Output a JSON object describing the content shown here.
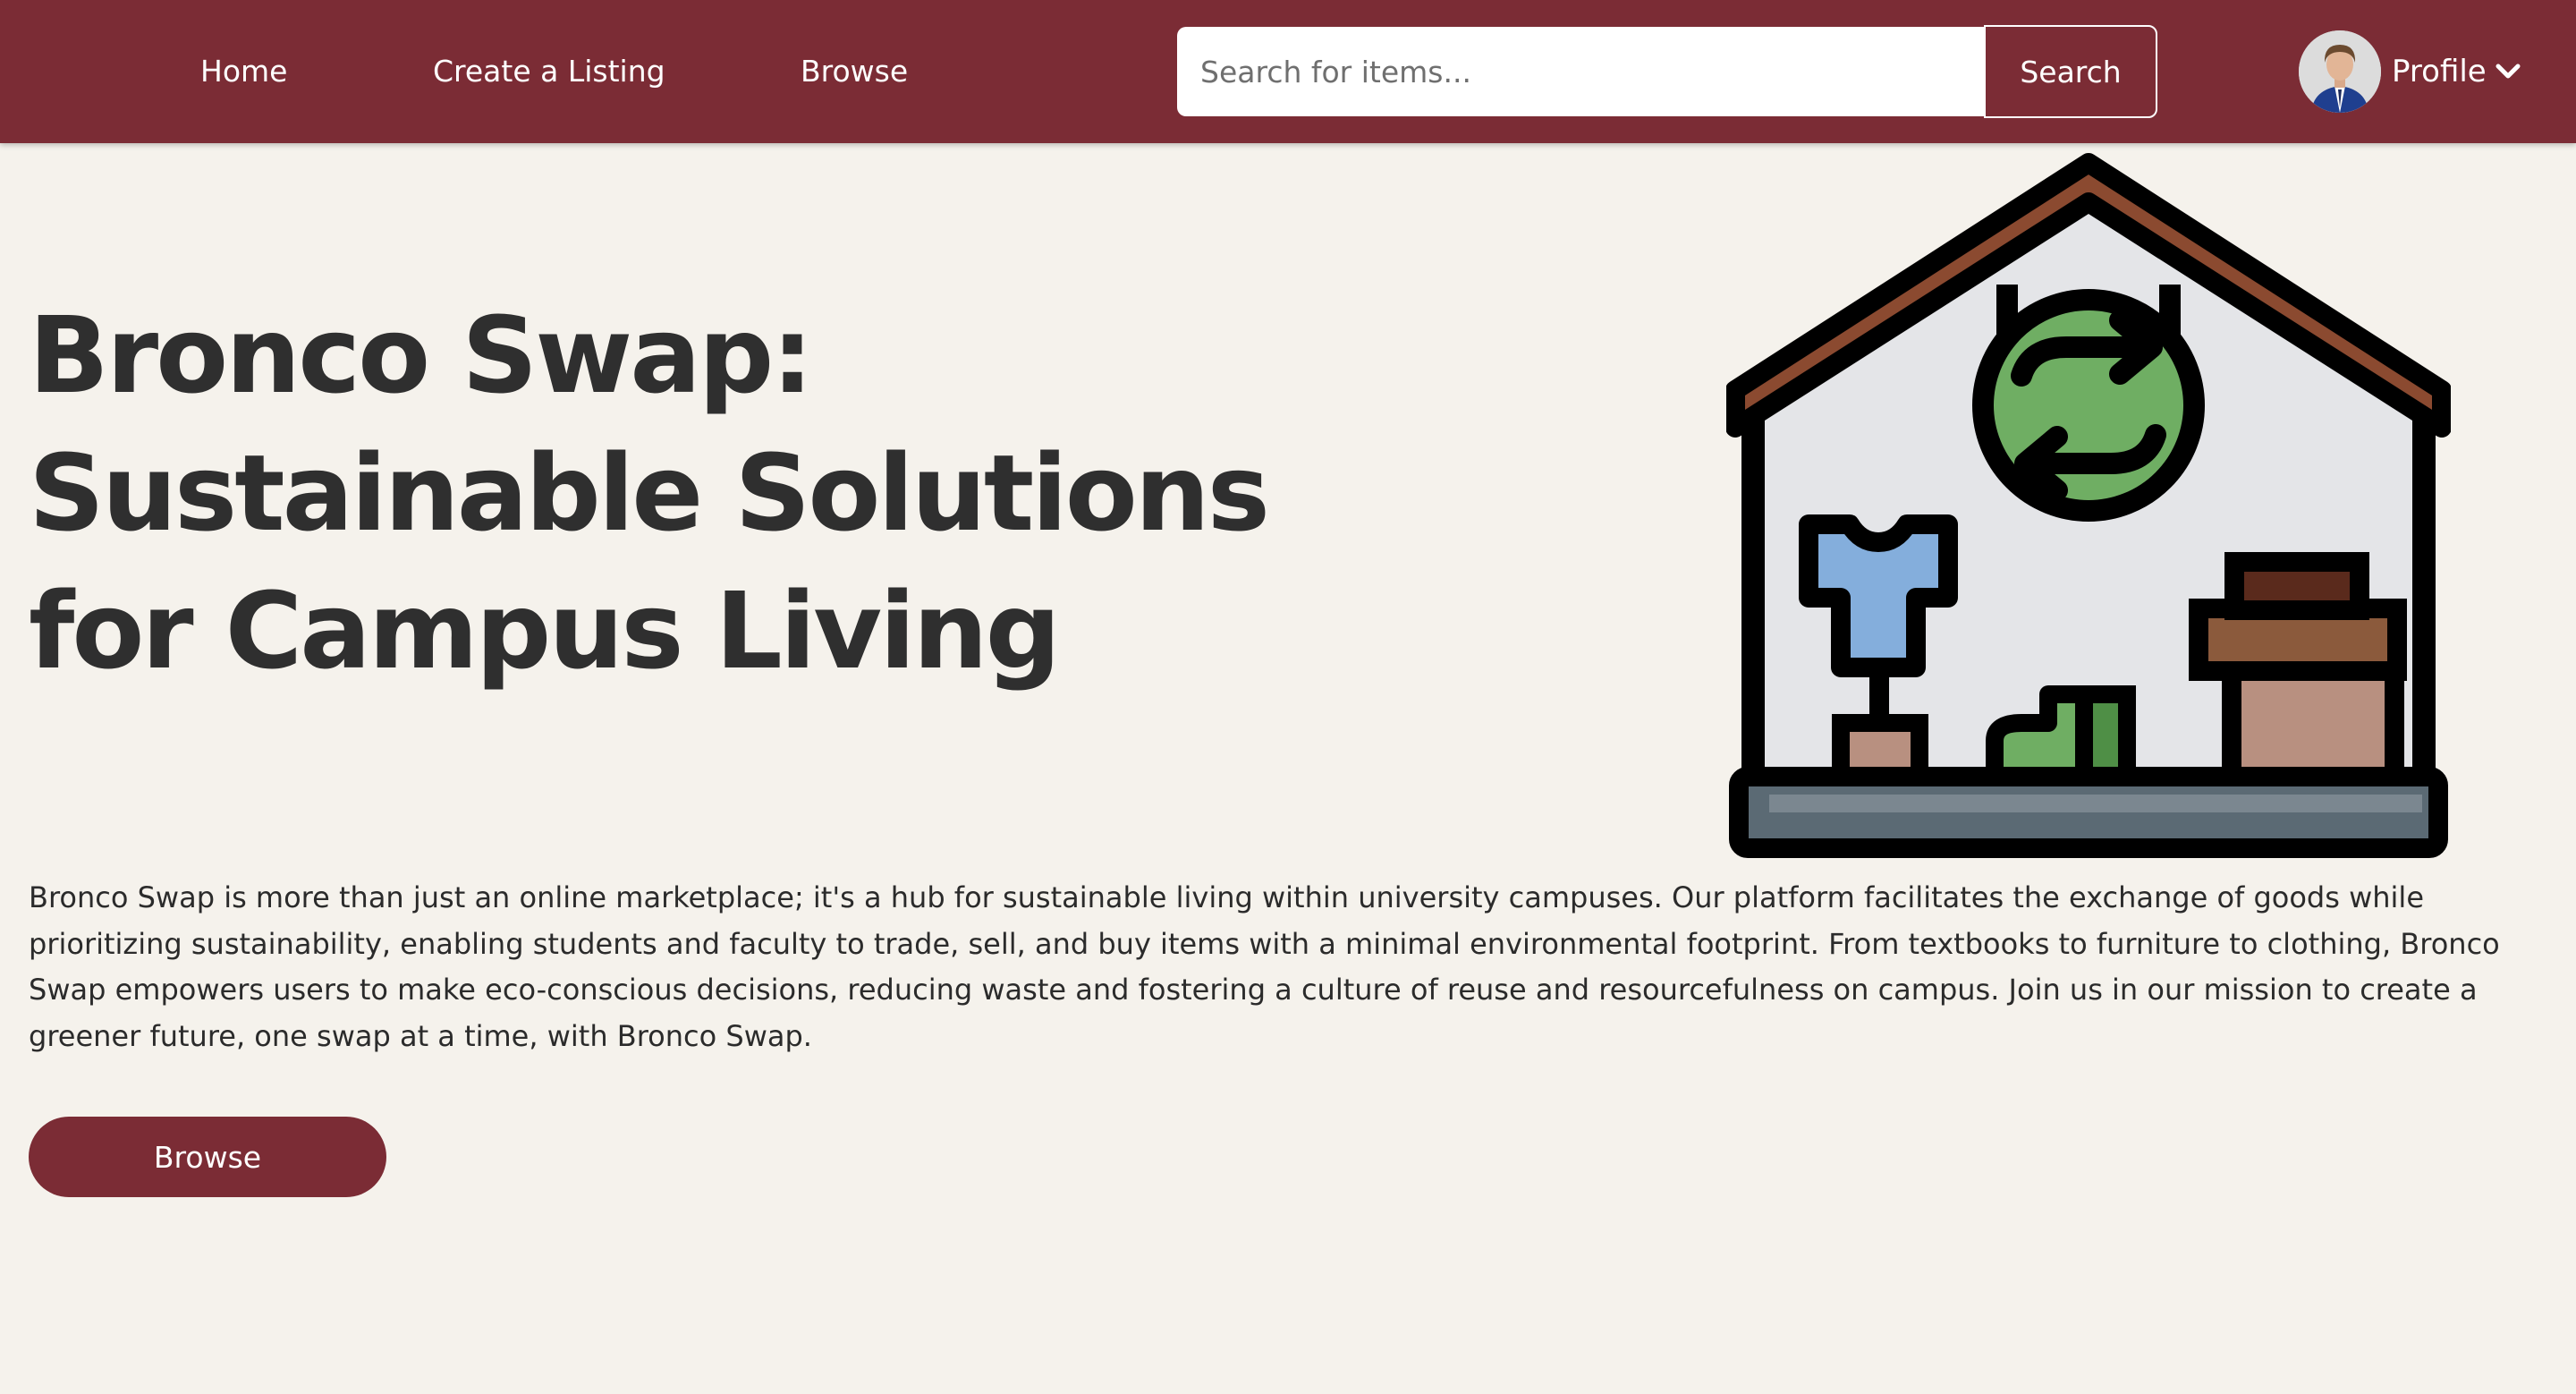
{
  "nav": {
    "links": [
      "Home",
      "Create a Listing",
      "Browse"
    ],
    "search_placeholder": "Search for items...",
    "search_button": "Search",
    "profile_label": "Profile"
  },
  "hero": {
    "title_lines": [
      "Bronco Swap:",
      "Sustainable Solutions",
      "for Campus Living"
    ],
    "description": "Bronco Swap is more than just an online marketplace; it's a hub for sustainable living within university campuses. Our platform facilitates the exchange of goods while prioritizing sustainability, enabling students and faculty to trade, sell, and buy items with a minimal environmental footprint. From textbooks to furniture to clothing, Bronco Swap empowers users to make eco-conscious decisions, reducing waste and fostering a culture of reuse and resourcefulness on campus. Join us in our mission to create a greener future, one swap at a time, with Bronco Swap.",
    "cta_label": "Browse"
  },
  "colors": {
    "brand": "#7b2c35",
    "background": "#f5f2ec",
    "text": "#2f2f2f"
  },
  "icons": [
    "chevron-down-icon",
    "swap-house-illustration"
  ]
}
